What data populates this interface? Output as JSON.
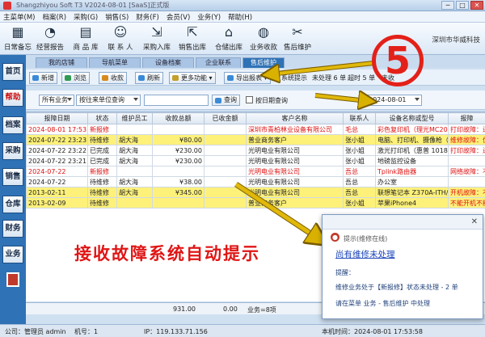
{
  "window": {
    "title": "Shangzhiyou Soft T3 V2024-08-01 [SaaS]正式版",
    "min": "─",
    "max": "□",
    "close": "✕"
  },
  "menu": [
    "主菜单(M)",
    "档案(R)",
    "采购(G)",
    "销售(S)",
    "财务(F)",
    "会员(V)",
    "业务(Y)",
    "帮助(H)"
  ],
  "toolbar": [
    {
      "label": "日常备忘",
      "icon": "calendar-icon",
      "glyph": "▦"
    },
    {
      "label": "经营报告",
      "icon": "report-icon",
      "glyph": "◔"
    },
    {
      "label": "商 品 库",
      "icon": "product-icon",
      "glyph": "▤"
    },
    {
      "label": "联 系 人",
      "icon": "contacts-icon",
      "glyph": "☺"
    },
    {
      "label": "采购入库",
      "icon": "purchase-icon",
      "glyph": "⇲"
    },
    {
      "label": "销售出库",
      "icon": "sales-icon",
      "glyph": "⇱"
    },
    {
      "label": "仓储出库",
      "icon": "warehouse-icon",
      "glyph": "⌂"
    },
    {
      "label": "业务收款",
      "icon": "payment-icon",
      "glyph": "◍"
    },
    {
      "label": "售后维护",
      "icon": "tools-icon",
      "glyph": "✂"
    }
  ],
  "company": "深圳市华威科技",
  "sidebar": [
    "首页",
    "帮助",
    "档案",
    "采购",
    "销售",
    "仓库",
    "财务",
    "业务"
  ],
  "tabs": [
    "我的店铺",
    "导航菜单",
    "设备档案",
    "企业联系",
    "售后维护"
  ],
  "actions": {
    "new": "新增",
    "browse": "浏览",
    "collect": "收款",
    "refresh": "刷新",
    "more": "更多功能",
    "export": "导出报表",
    "sys_prompt": "系统提示",
    "unhandled": "未处理 6 单",
    "overdue": "超时 5 单",
    "unpaid": "未收"
  },
  "filters": {
    "business": "所有业务",
    "query_mode": "按往来单位查询",
    "query_btn": "查询",
    "date_label": "按日期查询",
    "date_value": "2024-08-01"
  },
  "columns": [
    "报障日期",
    "状态",
    "维护员工",
    "收款总额",
    "已收金额",
    "客户名称",
    "联系人",
    "设备名称或型号",
    "报障"
  ],
  "rows": [
    {
      "date": "2024-08-01 17:53:",
      "status": "新报修",
      "staff": "",
      "total": "",
      "received": "",
      "customer": "深圳市青柏林业设备有限公司",
      "contact": "毛总",
      "device": "彩色复印机（理光MC2000)",
      "fault": "打印故障：进纸",
      "style": "red"
    },
    {
      "date": "2024-07-22 23:23:",
      "status": "待维修",
      "staff": "胡大海",
      "total": "¥80.00",
      "received": "",
      "customer": "普业商务客户",
      "contact": "张小姐",
      "device": "电脑、打印机、摄像枪（某某XX !",
      "fault": "维修故障：优化",
      "style": "yellow"
    },
    {
      "date": "2024-07-22 23:22:",
      "status": "已完成",
      "staff": "胡大海",
      "total": "¥230.00",
      "received": "",
      "customer": "光明电业有限公司",
      "contact": "张小姐",
      "device": "激光打印机（惠普 1018)",
      "fault": "打印故障：进纸",
      "style": ""
    },
    {
      "date": "2024-07-22 23:21:",
      "status": "已完成",
      "staff": "胡大海",
      "total": "¥230.00",
      "received": "",
      "customer": "光明电业有限公司",
      "contact": "张小姐",
      "device": "地磅监控设备",
      "fault": "",
      "style": ""
    },
    {
      "date": "2024-07-22",
      "status": "新报修",
      "staff": "",
      "total": "",
      "received": "",
      "customer": "光明电业有限公司",
      "contact": "吾总",
      "device": "Tplink路由器",
      "fault": "网络故障：不能",
      "style": "red"
    },
    {
      "date": "2024-07-22",
      "status": "待维修",
      "staff": "胡大海",
      "total": "¥38.00",
      "received": "",
      "customer": "光明电业有限公司",
      "contact": "吾总",
      "device": "办公室",
      "fault": "",
      "style": ""
    },
    {
      "date": "2013-02-11",
      "status": "待维修",
      "staff": "胡大海",
      "total": "¥345.00",
      "received": "",
      "customer": "光明电业有限公司",
      "contact": "吾总",
      "device": "联想笔记本 Z370A-ITH/ 13/ 2G 5",
      "fault": "开机故障：不能",
      "style": "yellow"
    },
    {
      "date": "2013-02-09",
      "status": "待维修",
      "staff": "",
      "total": "",
      "received": "",
      "customer": "普业商务客户",
      "contact": "张小姐",
      "device": "苹果iPhone4",
      "fault": "不能开机不能充",
      "style": "yellow"
    }
  ],
  "footer": {
    "total": "931.00",
    "received": "0.00",
    "count": "业务=8项"
  },
  "status": {
    "company": "公司：管理员 admin",
    "machine": "机号：1",
    "ip": "IP：119.133.71.156",
    "time": "本机时间：2024-08-01 17:53:58"
  },
  "popup": {
    "title": "提示(维修在线)",
    "link": "尚有维修未处理",
    "line1": "提醒：",
    "line2": "维修业务处于【新报修】状态未处理 - 2 单",
    "line3": "请在菜单 业务 - 售后维护 中处理",
    "close": "✕"
  },
  "badge": "5",
  "caption": "接收故障系统自动提示",
  "colors": {
    "accent": "#2f72b6",
    "alert": "#e32119",
    "highlight": "#fdf17a"
  }
}
